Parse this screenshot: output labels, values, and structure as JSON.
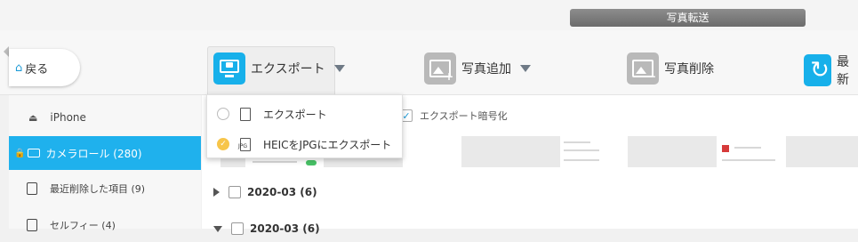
{
  "header": {
    "transfer_tab": "写真転送"
  },
  "toolbar": {
    "back_label": "戻る",
    "export_label": "エクスポート",
    "add_label": "写真追加",
    "delete_label": "写真削除",
    "sync_label": "最新",
    "icons": {
      "back": "home-icon",
      "export": "monitor-lock-icon",
      "add": "photo-add-icon",
      "delete": "photo-delete-icon",
      "sync": "sync-icon"
    },
    "colors": {
      "accent": "#17b0ea",
      "disabled": "#b9b9b9"
    }
  },
  "dropdown": {
    "items": [
      {
        "label": "エクスポート",
        "selected": false,
        "icon": "file-icon"
      },
      {
        "label": "HEICをJPGにエクスポート",
        "selected": true,
        "icon": "jpg-file-icon",
        "icon_text": "JPG"
      }
    ]
  },
  "sidebar": {
    "device": "iPhone",
    "items": [
      {
        "label": "カメラロール (280)",
        "active": true,
        "icon": "camera-icon"
      },
      {
        "label": "最近削除した項目 (9)",
        "active": false,
        "icon": "trash-icon"
      },
      {
        "label": "セルフィー (4)",
        "active": false,
        "icon": "portrait-icon"
      }
    ],
    "active_color": "#1fb1ed"
  },
  "content": {
    "encrypt_label": "エクスポート暗号化",
    "encrypt_checked": true,
    "groups": [
      {
        "label": "2020-03  (6)",
        "expanded": false
      },
      {
        "label": "2020-03  (6)",
        "expanded": true
      }
    ]
  }
}
